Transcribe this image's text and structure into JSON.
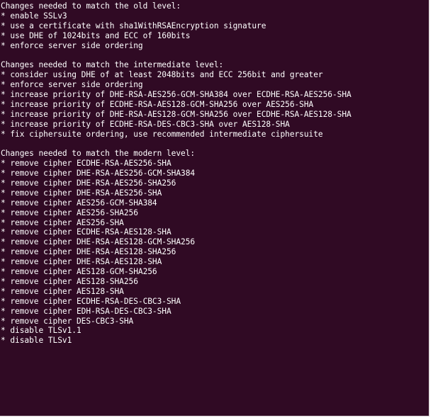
{
  "colors": {
    "background": "#300a24",
    "text": "#ffffff"
  },
  "sections": [
    {
      "heading": "Changes needed to match the old level:",
      "items": [
        "* enable SSLv3",
        "* use a certificate with sha1WithRSAEncryption signature",
        "* use DHE of 1024bits and ECC of 160bits",
        "* enforce server side ordering"
      ]
    },
    {
      "heading": "Changes needed to match the intermediate level:",
      "items": [
        "* consider using DHE of at least 2048bits and ECC 256bit and greater",
        "* enforce server side ordering",
        "* increase priority of DHE-RSA-AES256-GCM-SHA384 over ECDHE-RSA-AES256-SHA",
        "* increase priority of ECDHE-RSA-AES128-GCM-SHA256 over AES256-SHA",
        "* increase priority of DHE-RSA-AES128-GCM-SHA256 over ECDHE-RSA-AES128-SHA",
        "* increase priority of ECDHE-RSA-DES-CBC3-SHA over AES128-SHA",
        "* fix ciphersuite ordering, use recommended intermediate ciphersuite"
      ]
    },
    {
      "heading": "Changes needed to match the modern level:",
      "items": [
        "* remove cipher ECDHE-RSA-AES256-SHA",
        "* remove cipher DHE-RSA-AES256-GCM-SHA384",
        "* remove cipher DHE-RSA-AES256-SHA256",
        "* remove cipher DHE-RSA-AES256-SHA",
        "* remove cipher AES256-GCM-SHA384",
        "* remove cipher AES256-SHA256",
        "* remove cipher AES256-SHA",
        "* remove cipher ECDHE-RSA-AES128-SHA",
        "* remove cipher DHE-RSA-AES128-GCM-SHA256",
        "* remove cipher DHE-RSA-AES128-SHA256",
        "* remove cipher DHE-RSA-AES128-SHA",
        "* remove cipher AES128-GCM-SHA256",
        "* remove cipher AES128-SHA256",
        "* remove cipher AES128-SHA",
        "* remove cipher ECDHE-RSA-DES-CBC3-SHA",
        "* remove cipher EDH-RSA-DES-CBC3-SHA",
        "* remove cipher DES-CBC3-SHA",
        "* disable TLSv1.1",
        "* disable TLSv1"
      ]
    }
  ]
}
